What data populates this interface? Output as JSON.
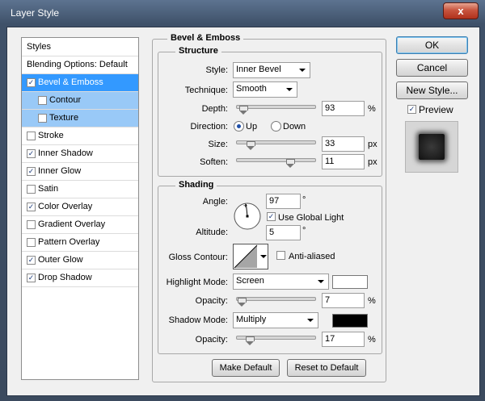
{
  "window": {
    "title": "Layer Style",
    "close_label": "x"
  },
  "styles_list": {
    "header": "Styles",
    "blending": "Blending Options: Default",
    "items": [
      {
        "label": "Bevel & Emboss",
        "checked": true
      },
      {
        "label": "Contour",
        "checked": false
      },
      {
        "label": "Texture",
        "checked": false
      },
      {
        "label": "Stroke",
        "checked": false
      },
      {
        "label": "Inner Shadow",
        "checked": true
      },
      {
        "label": "Inner Glow",
        "checked": true
      },
      {
        "label": "Satin",
        "checked": false
      },
      {
        "label": "Color Overlay",
        "checked": true
      },
      {
        "label": "Gradient Overlay",
        "checked": false
      },
      {
        "label": "Pattern Overlay",
        "checked": false
      },
      {
        "label": "Outer Glow",
        "checked": true
      },
      {
        "label": "Drop Shadow",
        "checked": true
      }
    ]
  },
  "bevel": {
    "section_title": "Bevel & Emboss",
    "structure_title": "Structure",
    "style_label": "Style:",
    "style_value": "Inner Bevel",
    "technique_label": "Technique:",
    "technique_value": "Smooth",
    "depth_label": "Depth:",
    "depth_value": "93",
    "depth_unit": "%",
    "direction_label": "Direction:",
    "direction_up": "Up",
    "direction_down": "Down",
    "size_label": "Size:",
    "size_value": "33",
    "size_unit": "px",
    "soften_label": "Soften:",
    "soften_value": "11",
    "soften_unit": "px"
  },
  "shading": {
    "title": "Shading",
    "angle_label": "Angle:",
    "angle_value": "97",
    "angle_unit": "°",
    "global_light_label": "Use Global Light",
    "altitude_label": "Altitude:",
    "altitude_value": "5",
    "altitude_unit": "°",
    "gloss_label": "Gloss Contour:",
    "anti_aliased_label": "Anti-aliased",
    "highlight_mode_label": "Highlight Mode:",
    "highlight_mode_value": "Screen",
    "highlight_color": "#ffffff",
    "opacity_label": "Opacity:",
    "highlight_opacity": "7",
    "opacity_unit": "%",
    "shadow_mode_label": "Shadow Mode:",
    "shadow_mode_value": "Multiply",
    "shadow_color": "#000000",
    "shadow_opacity": "17"
  },
  "buttons": {
    "make_default": "Make Default",
    "reset_default": "Reset to Default",
    "ok": "OK",
    "cancel": "Cancel",
    "new_style": "New Style...",
    "preview": "Preview"
  }
}
